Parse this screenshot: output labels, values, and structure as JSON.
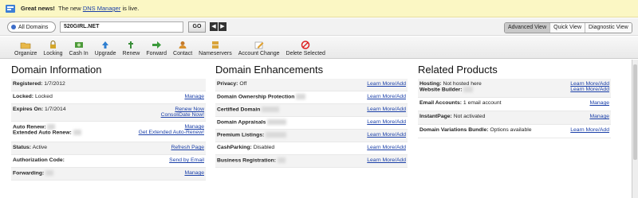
{
  "notice": {
    "headline": "Great news!",
    "text_before": "The new",
    "link": "DNS Manager",
    "text_after": "is live."
  },
  "domain_bar": {
    "all_domains": "All Domains",
    "domain": "520GIRL.NET",
    "go": "GO",
    "views": [
      "Advanced View",
      "Quick View",
      "Diagnostic View"
    ],
    "active_view": "Advanced View"
  },
  "toolbar": [
    "Organize",
    "Locking",
    "Cash In",
    "Upgrade",
    "Renew",
    "Forward",
    "Contact",
    "Nameservers",
    "Account Change",
    "Delete Selected"
  ],
  "domain_info": {
    "title": "Domain Information",
    "registered": {
      "label": "Registered:",
      "value": "1/7/2012"
    },
    "locked": {
      "label": "Locked:",
      "value": "Locked",
      "action": "Manage"
    },
    "expires": {
      "label": "Expires On:",
      "value": "1/7/2014",
      "action1": "Renew Now",
      "action2": "ConsoliDate Now!"
    },
    "auto_renew": {
      "label": "Auto Renew:",
      "action": "Manage"
    },
    "ext_auto_renew": {
      "label": "Extended Auto Renew:",
      "action": "Get Extended Auto-Renew!"
    },
    "status": {
      "label": "Status:",
      "value": "Active",
      "action": "Refresh Page"
    },
    "auth_code": {
      "label": "Authorization Code:",
      "action": "Send by Email"
    },
    "forwarding": {
      "label": "Forwarding:",
      "action": "Manage"
    }
  },
  "enhancements": {
    "title": "Domain Enhancements",
    "privacy": {
      "label": "Privacy:",
      "value": "Off",
      "action": "Learn More/Add"
    },
    "ownership": {
      "label": "Domain Ownership Protection",
      "action": "Learn More/Add"
    },
    "certified": {
      "label": "Certified Domain",
      "action": "Learn More/Add"
    },
    "appraisals": {
      "label": "Domain Appraisals",
      "action": "Learn More/Add"
    },
    "premium": {
      "label": "Premium Listings:",
      "action": "Learn More/Add"
    },
    "cashparking": {
      "label": "CashParking:",
      "value": "Disabled",
      "action": "Learn More/Add"
    },
    "business": {
      "label": "Business Registration:",
      "action": "Learn More/Add"
    }
  },
  "related": {
    "title": "Related Products",
    "hosting": {
      "label": "Hosting:",
      "value": "Not hosted here",
      "action": "Learn More/Add"
    },
    "website_builder": {
      "label": "Website Builder:",
      "action": "Learn More/Add"
    },
    "email": {
      "label": "Email Accounts:",
      "value": "1 email account",
      "action": "Manage"
    },
    "instantpage": {
      "label": "InstantPage:",
      "value": "Not activated",
      "action": "Manage"
    },
    "variations": {
      "label": "Domain Variations Bundle:",
      "value": "Options available",
      "action": "Learn More/Add"
    }
  }
}
